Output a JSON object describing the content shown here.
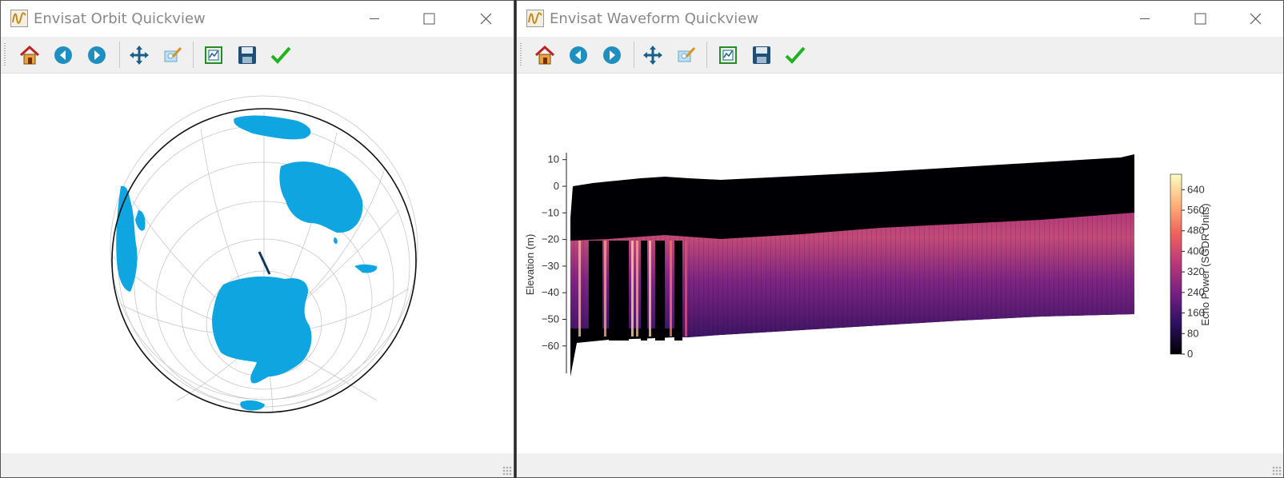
{
  "orbit_window": {
    "title": "Envisat Orbit Quickview",
    "land_color": "#0ea5e0",
    "graticule_color": "#c8c8c8",
    "toolbar": [
      {
        "name": "home-icon"
      },
      {
        "name": "back-arrow-icon"
      },
      {
        "name": "forward-arrow-icon"
      },
      {
        "name": "pan-icon"
      },
      {
        "name": "zoom-icon"
      },
      {
        "name": "configure-subplots-icon"
      },
      {
        "name": "save-icon"
      },
      {
        "name": "checkmark-icon"
      }
    ]
  },
  "waveform_window": {
    "title": "Envisat Waveform Quickview",
    "chart_data": {
      "type": "heatmap",
      "ylabel": "Elevation (m)",
      "yticks": [
        10,
        0,
        -10,
        -20,
        -30,
        -40,
        -50,
        -60
      ],
      "ylim": [
        -70,
        12
      ],
      "colormap": "magma",
      "colorbar": {
        "label": "Echo Power (SGDR Units)",
        "ticks": [
          640,
          560,
          480,
          400,
          320,
          240,
          160,
          80,
          0
        ],
        "range": [
          0,
          700
        ]
      },
      "colormap_stops": [
        "#000004",
        "#2c115f",
        "#721f81",
        "#b73779",
        "#f1605d",
        "#feb078",
        "#fcfdbf"
      ]
    }
  }
}
